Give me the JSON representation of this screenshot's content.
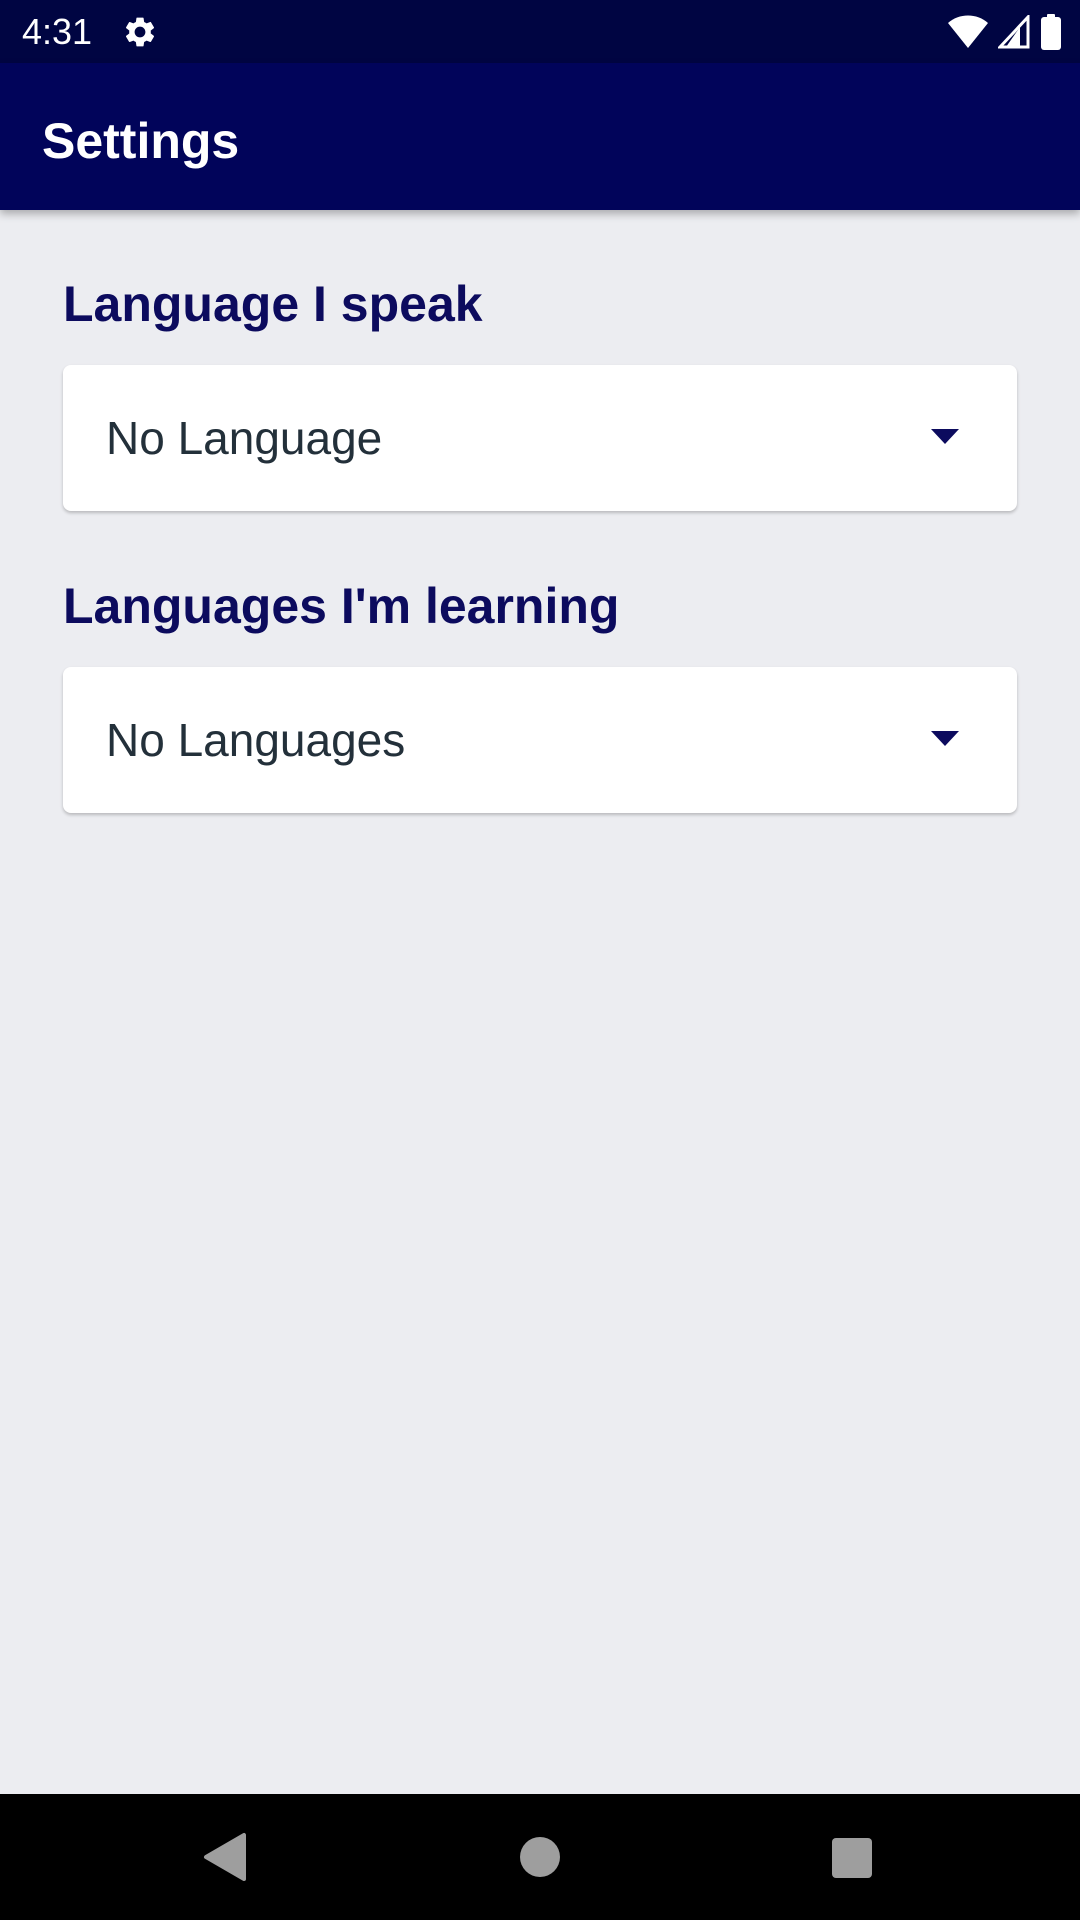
{
  "status_bar": {
    "time": "4:31",
    "icons": [
      "settings-gear-icon",
      "wifi-icon",
      "cell-signal-icon",
      "battery-icon"
    ]
  },
  "app_bar": {
    "title": "Settings"
  },
  "sections": [
    {
      "label": "Language I speak",
      "dropdown_value": "No Language"
    },
    {
      "label": "Languages I'm learning",
      "dropdown_value": "No Languages"
    }
  ],
  "nav_bar": {
    "icons": [
      "back-icon",
      "home-icon",
      "recents-icon"
    ]
  },
  "colors": {
    "status_bar_bg": "#000542",
    "app_bar_bg": "#01045a",
    "accent": "#0c0b5e",
    "background": "#ecedf1",
    "dropdown_text": "#23303a"
  }
}
